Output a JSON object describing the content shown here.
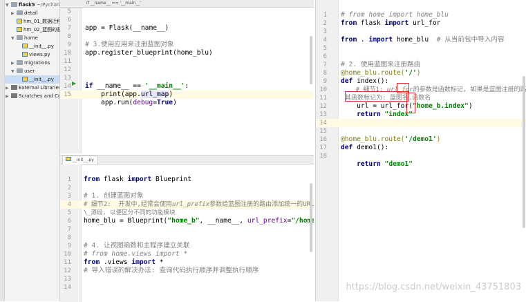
{
  "project": {
    "root_name": "flask5",
    "root_path": "~/PycharmP",
    "items": [
      {
        "label": "detail",
        "type": "folder",
        "indent": 1,
        "arrow": "▶"
      },
      {
        "label": "hm_01_数据迁移..",
        "type": "py",
        "indent": 1,
        "arrow": ""
      },
      {
        "label": "hm_02_蓝图的基..",
        "type": "py",
        "indent": 1,
        "arrow": ""
      },
      {
        "label": "home",
        "type": "folder",
        "indent": 1,
        "arrow": "▼"
      },
      {
        "label": "__init__.py",
        "type": "py",
        "indent": 2,
        "arrow": ""
      },
      {
        "label": "views.py",
        "type": "py",
        "indent": 2,
        "arrow": ""
      },
      {
        "label": "migrations",
        "type": "folder",
        "indent": 1,
        "arrow": "▶"
      },
      {
        "label": "user",
        "type": "folder",
        "indent": 1,
        "arrow": "▼"
      },
      {
        "label": "__init__.py",
        "type": "py",
        "indent": 2,
        "arrow": "",
        "selected": true
      },
      {
        "label": "External Libraries",
        "type": "lib",
        "indent": 0,
        "arrow": "▶"
      },
      {
        "label": "Scratches and Consoles",
        "type": "lib",
        "indent": 0,
        "arrow": "▶"
      }
    ]
  },
  "editor_top": {
    "breadcrumb": "if __name__ == '__main__'",
    "line_numbers": [
      "5",
      "6",
      "7",
      "8",
      "9",
      "10",
      "11",
      "12",
      "13",
      "14",
      "15"
    ]
  },
  "editor_bottom": {
    "tab": "__init__.py",
    "line_numbers": [
      "1",
      "2",
      "3",
      "4",
      "5",
      "6",
      "7",
      "8",
      "9",
      "10",
      "11",
      "12",
      "13",
      "14"
    ]
  },
  "editor_right": {
    "line_numbers": [
      "1",
      "2",
      "3",
      "4",
      "5",
      "6",
      "7",
      "8",
      "9",
      "10",
      "11",
      "12",
      "13",
      "14",
      "15",
      "16",
      "17",
      "18"
    ]
  },
  "code_text": {
    "t7": "app = Flask(__name__)",
    "t9": "# 3.使用应用来注册蓝图对象",
    "t10": "app.register_blueprint(home_blu)",
    "t13_if": "if ",
    "t13_name": "__name__ == ",
    "t13_main": "'__main__'",
    "t13_colon": ":",
    "t14_pre": "    print(app.",
    "t14_attr": "url_map",
    "t14_post": ")",
    "t15_pre": "    app.run(",
    "t15_kw": "debug",
    "t15_eq": "=",
    "t15_true": "True",
    "t15_post": ")",
    "b1_from": "from ",
    "b1_mid": "flask ",
    "b1_import": "import ",
    "b1_name": "Blueprint",
    "b3": "# 1. 创建蓝图对象",
    "b4a": "# 细节2:  开发中,经常会使用",
    "b4b": "url_prefix",
    "b4c": "参数给蓝图注册的路由添加统一的URL资/",
    "b4d": "\\_源段, 以便区分不同的功能模块",
    "b5_pre": "home_blu = Blueprint(",
    "b5_s1": "\"home_b\"",
    "b5_mid": ", __name__, ",
    "b5_kw": "url_prefix",
    "b5_eq": "=",
    "b5_s2": "\"/home\"",
    "b5_post": ")",
    "b9": "# 4. 让视图函数和主程序建立关联",
    "b10": "# from home.views import *",
    "b11_from": "from ",
    "b11_mid": ".views ",
    "b11_import": "import ",
    "b11_star": "*",
    "b12": "# 导入错误的解决办法: 查询代码执行顺序并调整执行顺序",
    "r1": "# from home import home_blu",
    "r2_from": "from ",
    "r2_mid": "flask ",
    "r2_import": "import ",
    "r2_name": "url_for",
    "r4_from": "from ",
    "r4_mid": ". ",
    "r4_import": "import ",
    "r4_name": "home_blu  ",
    "r4_cm": "# 从当前包中导入内容",
    "r7": "# 2. 使用蓝图来注册路由",
    "r8_dec": "@home_blu.route(",
    "r8_str": "'/'",
    "r8_end": ")",
    "r9_def": "def ",
    "r9_name": "index():",
    "r10a": "    # 细节1: ",
    "r10b": "url_for",
    "r10c": "的参数是函数标记, 如果是蓝图注册的路由,",
    "r10d": "其函数标记为: 蓝图名.函数名",
    "r11_pre": "    url = url_for(",
    "r11_str": "\"home_b.index\"",
    "r11_post": ")",
    "r12_ret": "    return ",
    "r12_str": "\"index\"",
    "r15_dec": "@home_blu.route(",
    "r15_str": "'/demo1'",
    "r15_end": ")",
    "r16_def": "def ",
    "r16_name": "demo1():",
    "r17_ret": "    return ",
    "r17_str": "\"demo1\""
  },
  "watermark": "https://blog.csdn.net/weixin_43751803"
}
